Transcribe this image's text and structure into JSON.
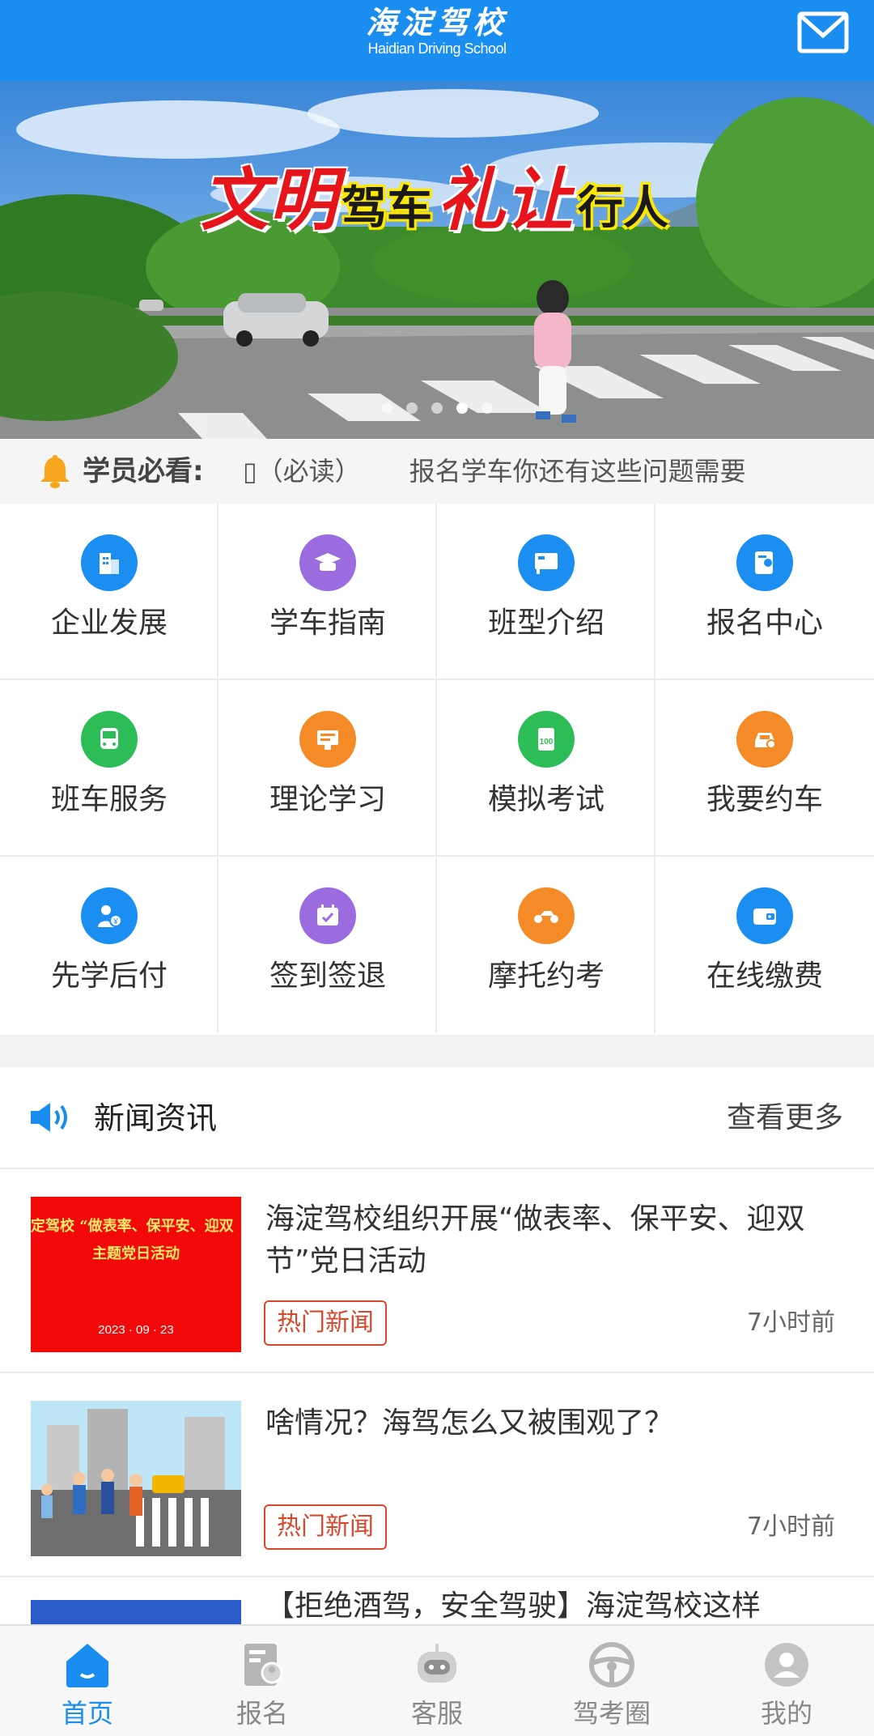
{
  "header": {
    "logo_cn": "海淀驾校",
    "logo_en": "Haidian Driving School"
  },
  "banner": {
    "slogan": [
      "文明",
      "驾车",
      "礼让",
      "行人"
    ],
    "dots_total": 5,
    "dot_active": 4
  },
  "notice": {
    "label": "学员必看:",
    "icon_placeholder": "▯",
    "text_a": "（必读）",
    "text_b": "报名学车你还有这些问题需要"
  },
  "grid": {
    "items": [
      {
        "label": "企业发展",
        "icon": "building-icon",
        "color": "#1b8ef2"
      },
      {
        "label": "学车指南",
        "icon": "graduation-icon",
        "color": "#9b6be0"
      },
      {
        "label": "班型介绍",
        "icon": "chalkboard-icon",
        "color": "#1b8ef2"
      },
      {
        "label": "报名中心",
        "icon": "signup-icon",
        "color": "#1b8ef2"
      },
      {
        "label": "班车服务",
        "icon": "bus-icon",
        "color": "#2dbd57"
      },
      {
        "label": "理论学习",
        "icon": "book-icon",
        "color": "#f48b26"
      },
      {
        "label": "模拟考试",
        "icon": "exam-icon",
        "color": "#2dbd57"
      },
      {
        "label": "我要约车",
        "icon": "car-icon",
        "color": "#f48b26"
      },
      {
        "label": "先学后付",
        "icon": "pay-later-icon",
        "color": "#1b8ef2"
      },
      {
        "label": "签到签退",
        "icon": "calendar-icon",
        "color": "#9b6be0"
      },
      {
        "label": "摩托约考",
        "icon": "motorcycle-icon",
        "color": "#f48b26"
      },
      {
        "label": "在线缴费",
        "icon": "wallet-icon",
        "color": "#1b8ef2"
      }
    ]
  },
  "news": {
    "title": "新闻资讯",
    "more": "查看更多",
    "items": [
      {
        "title": "海淀驾校组织开展“做表率、保平安、迎双节”党日活动",
        "tag": "热门新闻",
        "time": "7小时前",
        "thumb_line1": "定驾校 “做表率、保平安、迎双",
        "thumb_line2": "主题党日活动",
        "thumb_date": "2023 · 09 · 23"
      },
      {
        "title": "啥情况？海驾怎么又被围观了？",
        "tag": "热门新闻",
        "time": "7小时前"
      },
      {
        "title": "【拒绝酒驾，安全驾驶】海淀驾校这样"
      }
    ]
  },
  "tabbar": {
    "items": [
      {
        "label": "首页",
        "icon": "home-icon"
      },
      {
        "label": "报名",
        "icon": "signup-form-icon"
      },
      {
        "label": "客服",
        "icon": "robot-service-icon"
      },
      {
        "label": "驾考圈",
        "icon": "steering-wheel-icon"
      },
      {
        "label": "我的",
        "icon": "user-profile-icon"
      }
    ],
    "active": 0
  },
  "colors": {
    "brand_blue": "#1a8ef0",
    "tag_red": "#d9472b"
  }
}
